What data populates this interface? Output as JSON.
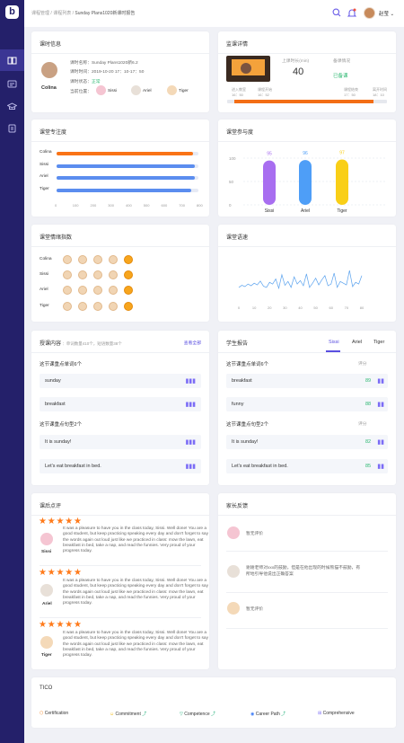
{
  "breadcrumb": {
    "items": [
      "课程管理",
      "课程列表",
      "Sunday Plans1020新课时报告"
    ],
    "sep": " / "
  },
  "user": {
    "name": "赵莹",
    "chevron": "⌄"
  },
  "sidebar": {
    "logo": "b",
    "items": [
      "book-icon",
      "id-card-icon",
      "graduation-icon",
      "document-icon"
    ]
  },
  "lesson_info": {
    "title": "课时信息",
    "student": "Colina",
    "lines": [
      "课时名称：Sunday Plans1020新6.2",
      "课时时间：2019-10-20 17：10-17：50",
      "课时状态：",
      "当前位置："
    ],
    "status": "正常",
    "position_students": [
      "Sissi",
      "Ariel",
      "Tiger"
    ]
  },
  "supervise": {
    "title": "监课详情",
    "online_label": "上课时长(min)",
    "online_value": "40",
    "prep_label": "备课情况",
    "prep_value": "已备课",
    "timeline": [
      {
        "label": "进入教室",
        "time": "16：50"
      },
      {
        "label": "课程开始",
        "time": "16：52"
      },
      {
        "label": "课程结束",
        "time": "17：50"
      },
      {
        "label": "离开时间",
        "time": "18：10"
      }
    ]
  },
  "focus": {
    "title": "课堂专注度",
    "names": [
      "Colina",
      "Sissi",
      "Ariel",
      "Tiger"
    ],
    "xticks": [
      "0",
      "100",
      "200",
      "300",
      "400",
      "500",
      "600",
      "700",
      "800"
    ]
  },
  "participation": {
    "title": "课堂参与度",
    "yticks": [
      "100",
      "50",
      "0"
    ]
  },
  "emotion": {
    "title": "课堂情绪指数",
    "names": [
      "Colina",
      "Sissi",
      "Ariel",
      "Tiger"
    ]
  },
  "speed": {
    "title": "课堂语速",
    "xticks": [
      "0",
      "10",
      "20",
      "30",
      "40",
      "50",
      "60",
      "70",
      "80"
    ]
  },
  "content": {
    "title": "授课内容",
    "subtitle": "单词数量410个，短语数量38个",
    "view_all": "查看全部",
    "words_title": "这节课重点单词6个",
    "words": [
      "sunday",
      "breakfast"
    ],
    "sentences_title": "这节课重点句型2个",
    "sentences": [
      "It is sunday!",
      "Let's eat breakfast in bed."
    ]
  },
  "report": {
    "title": "学生报告",
    "tabs": [
      "Sissi",
      "Ariel",
      "Tiger"
    ],
    "words_title": "这节课重点单词6个",
    "sentences_title": "这节课重点句型2个",
    "score_label": "评分",
    "words": [
      {
        "text": "breakfast",
        "score": "89"
      },
      {
        "text": "funny",
        "score": "88"
      }
    ],
    "sentences": [
      {
        "text": "It is sunday!",
        "score": "82"
      },
      {
        "text": "Let's eat breakfast in bed.",
        "score": "85"
      }
    ]
  },
  "reviews": {
    "title": "课后点评",
    "items": [
      {
        "name": "Sissi",
        "stars": "★ ★ ★ ★ ★",
        "text": "It was a pleasure to have you in the class today, Sissi. Well done! You are a good student, but keep practicing speaking every day and don't forget to say the words again out loud just like we practiced in class: mow the lawn, eat breakfast in bed, take a nap, and read the funnies. Very proud of your progress today."
      },
      {
        "name": "Ariel",
        "stars": "★ ★ ★ ★ ★",
        "text": "It was a pleasure to have you in the class today, Sissi. Well done! You are a good student, but keep practicing speaking every day and don't forget to say the words again out loud just like we practiced in class: mow the lawn, eat breakfast in bed, take a nap, and read the funnies. Very proud of your progress today."
      },
      {
        "name": "Tiger",
        "stars": "★ ★ ★ ★ ★",
        "text": "It was a pleasure to have you in the class today, Sissi. Well done! You are a good student, but keep practicing speaking every day and don't forget to say the words again out loud just like we practiced in class: mow the lawn, eat breakfast in bed, take a nap, and read the funnies. Very proud of your progress today."
      }
    ]
  },
  "parent": {
    "title": "家长反馈",
    "items": [
      {
        "text": "暂无评价"
      },
      {
        "text": "谢谢老师对xxx的鼓励，但是在他出现的时候熊猫不鼓励，有所地引导他说出正确答案"
      },
      {
        "text": "暂无评价"
      }
    ]
  },
  "tico": {
    "title": "TICO",
    "items": [
      {
        "label": "Certification",
        "icon": "medal-icon",
        "color": "#f58a2a"
      },
      {
        "label": "Commitment",
        "icon": "smile-icon",
        "color": "#f2b705"
      },
      {
        "label": "Competence",
        "icon": "shield-icon",
        "color": "#21b07a"
      },
      {
        "label": "Career Path",
        "icon": "target-icon",
        "color": "#3b7bf6"
      },
      {
        "label": "Comprehensive",
        "icon": "grid-icon",
        "color": "#7b6cf6"
      }
    ]
  },
  "chart_data": [
    {
      "type": "bar",
      "title": "课堂专注度",
      "categories": [
        "Colina",
        "Sissi",
        "Ariel",
        "Tiger"
      ],
      "series": [
        {
          "values": [
            770,
            780,
            780,
            760
          ]
        }
      ],
      "xlim": [
        0,
        800
      ],
      "colors": [
        "#f97316",
        "#5b8def",
        "#5b8def",
        "#5b8def"
      ]
    },
    {
      "type": "bar",
      "title": "课堂参与度",
      "categories": [
        "Sissi",
        "Ariel",
        "Tiger"
      ],
      "values": [
        95,
        96,
        97
      ],
      "ylim": [
        0,
        100
      ],
      "colors": [
        "#a86ef0",
        "#4e9ef7",
        "#f9cf17"
      ]
    },
    {
      "type": "line",
      "title": "课堂语速",
      "x": [
        0,
        2,
        4,
        6,
        8,
        10,
        12,
        14,
        16,
        18,
        20,
        22,
        24,
        26,
        28,
        30,
        32,
        34,
        36,
        38,
        40,
        42,
        44,
        46,
        48,
        50,
        52,
        54,
        56,
        58,
        60,
        62,
        64,
        66,
        68,
        70,
        72,
        74,
        76,
        78,
        80
      ],
      "y": [
        30,
        35,
        32,
        38,
        34,
        40,
        36,
        45,
        33,
        30,
        42,
        38,
        50,
        28,
        60,
        35,
        44,
        30,
        55,
        38,
        46,
        34,
        62,
        30,
        40,
        52,
        36,
        48,
        58,
        34,
        38,
        64,
        30,
        44,
        40,
        36,
        70,
        32,
        42,
        38,
        58
      ],
      "xlim": [
        0,
        80
      ],
      "ylim": [
        0,
        100
      ]
    }
  ]
}
